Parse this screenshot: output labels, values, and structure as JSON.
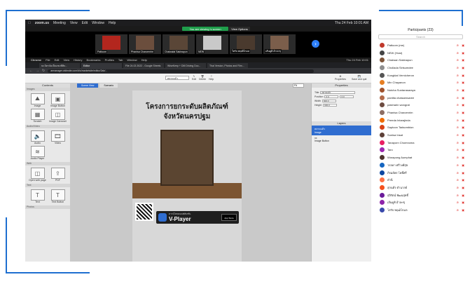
{
  "mac_menu": {
    "apple": "",
    "app": "zoom.us",
    "items": [
      "Meeting",
      "View",
      "Edit",
      "Window",
      "Help"
    ],
    "status_right": "Thu 24 Feb 10:01 AM"
  },
  "zoom": {
    "viewing_banner": "You are viewing 's screen",
    "view_options": "View Options",
    "gallery": [
      {
        "name": "Pattoom"
      },
      {
        "name": "Phanisa Charoenrim"
      },
      {
        "name": "Chaiwalai Sakinapun"
      },
      {
        "name": "NEW"
      },
      {
        "name": "โสรัจ พฤฒิโกมล"
      },
      {
        "name": "เส้นดูคิ อ้าละซุ"
      }
    ],
    "next_label": "›"
  },
  "chrome": {
    "menu": [
      "Chrome",
      "File",
      "Edit",
      "View",
      "History",
      "Bookmarks",
      "Profiles",
      "Tab",
      "Window",
      "Help"
    ],
    "clock": "Thu 24 Feb 10:01",
    "tabs": [
      {
        "label": "ss มิตรจัดเยี่ยมชมพิพิธ..."
      },
      {
        "label": "Editor"
      },
      {
        "label": "File 24.02.2022 - Google Sheets"
      },
      {
        "label": "WiseKeep + DM Driving Doc..."
      },
      {
        "label": "Thai Version, Photos and Film..."
      }
    ],
    "url": "armanager.vidinsite.com/#/s/marketsite/editor/2ab/..."
  },
  "app": {
    "toolbar": {
      "edit": "Edit",
      "delete": "Delete",
      "help": "Help",
      "properties": "Properties",
      "save": "Save and quit",
      "page_select": "ตลาดแล้ว"
    },
    "contents_title": "Contents",
    "sections": {
      "images": "Images",
      "video": "Audio/Video",
      "web": "Web",
      "text": "Text",
      "photos": "Photos"
    },
    "items": {
      "image": "Image",
      "image_button": "Image Button",
      "scratch": "Scratch",
      "image_carousel": "Image Carousel",
      "audio": "Audio",
      "video": "Video",
      "audio_player": "Audio Player",
      "open_web": "Open web page",
      "pdf": "PDF",
      "text": "Text",
      "text_button": "Text Button",
      "tooltip": "Text"
    },
    "canvas_tabs": {
      "scene_view": "Scene View",
      "scenario": "Scenario"
    },
    "zoom_value": "Fit",
    "poster": {
      "line1": "โครงการยกระดับผลิตภัณฑ์",
      "line2": "จังหวัดนครปฐม",
      "brand": "V-Player",
      "brand_tag": "ดาวน์โหลดแอปพลิเคชั่น",
      "store": "App Store"
    },
    "properties": {
      "title": "Properties",
      "title_label": "Title",
      "title_value": "ตลาดแล้ว",
      "pos_label": "Position",
      "pos_x": "0.0",
      "pos_y": "0.0",
      "width_label": "Width",
      "width_value": "600.0",
      "height_label": "Height",
      "height_value": "600.0",
      "layers": "Layers",
      "layer1_name": "ตลาดแล้ว",
      "layer1_type": "Image",
      "layer2_name": "xx",
      "layer2_type": "Image Button"
    }
  },
  "participants": {
    "title": "Participants (23)",
    "search": "Search",
    "list": [
      {
        "name": "Pattoom (me)",
        "color": "#c0392b"
      },
      {
        "name": "NEW (Host)",
        "color": "#444444"
      },
      {
        "name": "Chaiwan Sakinapun",
        "color": "#7f5539"
      },
      {
        "name": "Chollada Sirisumdee",
        "color": "#8e8e8e"
      },
      {
        "name": "Kongkiat Vernicheron",
        "color": "#555555"
      },
      {
        "name": "Min Chayanon",
        "color": "#e67e22"
      },
      {
        "name": "Nutcha Suntarasaraya",
        "color": "#a0522d"
      },
      {
        "name": "pantita chaisarnsaree",
        "color": "#b36b4a"
      },
      {
        "name": "patcharin wongrat",
        "color": "#6d4c41"
      },
      {
        "name": "Phanisa Charoenrim",
        "color": "#8d6e63"
      },
      {
        "name": "Preeda Intarajinda",
        "color": "#ef6c00"
      },
      {
        "name": "Saptoon Tadsombion",
        "color": "#d84315"
      },
      {
        "name": "Sunisa Insat",
        "color": "#5d4037"
      },
      {
        "name": "Tanaporn Chomnoma",
        "color": "#e91e63"
      },
      {
        "name": "Taro",
        "color": "#9c27b0"
      },
      {
        "name": "Worapong Aumphat",
        "color": "#4e342e"
      },
      {
        "name": "วรลดา ศรีวงศ์สุข",
        "color": "#1565c0"
      },
      {
        "name": "ภิรมย์พร โพธิ์ศรี",
        "color": "#0d47a1"
      },
      {
        "name": "ดำนี",
        "color": "#ff7043"
      },
      {
        "name": "สุกนต์ร ดำนาลย์",
        "color": "#f4511e"
      },
      {
        "name": "สุจิรัตน์ พัฒนสุทธิ์",
        "color": "#6a1b9a"
      },
      {
        "name": "เส้นดูคิ อ้าละซุ",
        "color": "#8e24aa"
      },
      {
        "name": "โสรัจ พฤฒิโกมล",
        "color": "#3949ab"
      }
    ]
  }
}
